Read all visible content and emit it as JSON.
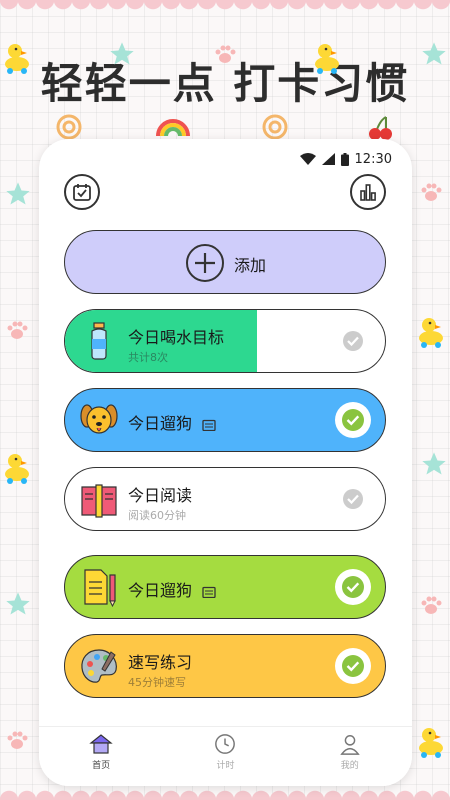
{
  "headline": "轻轻一点 打卡习惯",
  "status_bar": {
    "time": "12:30",
    "icons": [
      "wifi-icon",
      "signal-icon",
      "battery-icon"
    ]
  },
  "header": {
    "left_icon": "checklist-calendar-icon",
    "right_icon": "bar-chart-icon"
  },
  "add_button": {
    "label": "添加",
    "icon": "plus-icon",
    "color": "#cfcdfa"
  },
  "habits": [
    {
      "title": "今日喝水目标",
      "subtitle": "共计8次",
      "icon": "water-bottle-icon",
      "color": "#2dd890",
      "progress": 0.6,
      "checked": false,
      "has_calendar_icon": false
    },
    {
      "title": "今日遛狗",
      "subtitle": "",
      "icon": "dog-icon",
      "color": "#4fb3fb",
      "progress": 1.0,
      "checked": true,
      "has_calendar_icon": true
    },
    {
      "title": "今日阅读",
      "subtitle": "阅读60分钟",
      "icon": "book-icon",
      "color": "#ffffff",
      "progress": 0.0,
      "checked": false,
      "has_calendar_icon": false
    },
    {
      "title": "今日遛狗",
      "subtitle": "",
      "icon": "notebook-pencil-icon",
      "color": "#a5dc40",
      "progress": 1.0,
      "checked": true,
      "has_calendar_icon": true
    },
    {
      "title": "速写练习",
      "subtitle": "45分钟速写",
      "icon": "palette-icon",
      "color": "#fec746",
      "progress": 1.0,
      "checked": true,
      "has_calendar_icon": false
    }
  ],
  "bottom_nav": [
    {
      "label": "首页",
      "icon": "home-icon",
      "active": true
    },
    {
      "label": "计时",
      "icon": "clock-icon",
      "active": false
    },
    {
      "label": "我的",
      "icon": "profile-icon",
      "active": false
    }
  ],
  "colors": {
    "check_active": "#8ac43f",
    "check_inactive": "#cccccc",
    "outline": "#333333"
  }
}
